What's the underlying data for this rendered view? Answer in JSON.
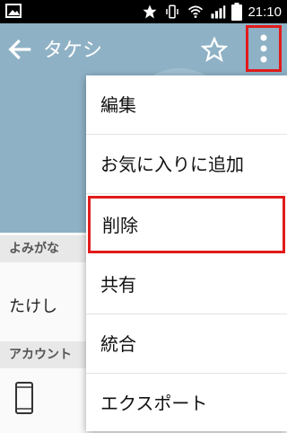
{
  "status_bar": {
    "time": "21:10",
    "icons": [
      "image-icon",
      "star-icon",
      "vibrate-icon",
      "wifi-icon",
      "signal-icon",
      "battery-icon"
    ]
  },
  "header": {
    "contact_name": "タケシ",
    "icons": [
      "back-arrow-icon",
      "star-outline-icon",
      "overflow-menu-icon"
    ]
  },
  "details": {
    "reading_label": "よみがな",
    "reading_value": "たけし",
    "account_label": "アカウント",
    "account_icon": "phone-icon"
  },
  "menu": {
    "items": [
      {
        "label": "編集"
      },
      {
        "label": "お気に入りに追加"
      },
      {
        "label": "削除",
        "highlighted": true
      },
      {
        "label": "共有"
      },
      {
        "label": "統合"
      },
      {
        "label": "エクスポート"
      }
    ]
  },
  "colors": {
    "header_bg": "#8eb1c5",
    "highlight_border": "#e21b1b"
  }
}
